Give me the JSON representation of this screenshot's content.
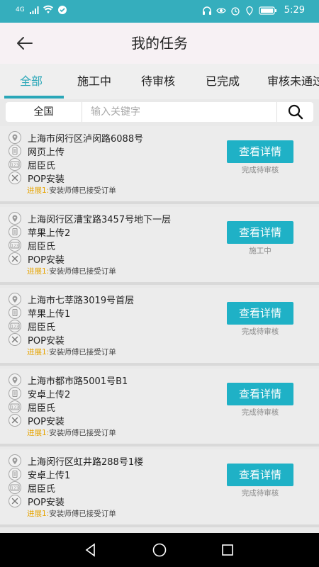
{
  "statusbar": {
    "signal": "4G",
    "time": "5:29"
  },
  "header": {
    "title": "我的任务"
  },
  "tabs": [
    {
      "label": "全部",
      "active": true
    },
    {
      "label": "施工中"
    },
    {
      "label": "待审核"
    },
    {
      "label": "已完成"
    },
    {
      "label": "审核未通过"
    }
  ],
  "search": {
    "region": "全国",
    "placeholder": "输入关键字"
  },
  "tasks": [
    {
      "address": "上海市闵行区泸闵路6088号",
      "upload": "网页上传",
      "name": "屈臣氏",
      "type": "POP安装",
      "progress_tag": "进展1:",
      "progress_text": "安装师傅已接受订单",
      "button": "查看详情",
      "status": "完成待审核"
    },
    {
      "address": "上海闵行区漕宝路3457号地下一层",
      "upload": "苹果上传2",
      "name": "屈臣氏",
      "type": "POP安装",
      "progress_tag": "进展1:",
      "progress_text": "安装师傅已接受订单",
      "button": "查看详情",
      "status": "施工中"
    },
    {
      "address": "上海市七莘路3019号首层",
      "upload": "苹果上传1",
      "name": "屈臣氏",
      "type": "POP安装",
      "progress_tag": "进展1:",
      "progress_text": "安装师傅已接受订单",
      "button": "查看详情",
      "status": "完成待审核"
    },
    {
      "address": "上海市都市路5001号B1",
      "upload": "安卓上传2",
      "name": "屈臣氏",
      "type": "POP安装",
      "progress_tag": "进展1:",
      "progress_text": "安装师傅已接受订单",
      "button": "查看详情",
      "status": "完成待审核"
    },
    {
      "address": "上海闵行区虹井路288号1楼",
      "upload": "安卓上传1",
      "name": "屈臣氏",
      "type": "POP安装",
      "progress_tag": "进展1:",
      "progress_text": "安装师傅已接受订单",
      "button": "查看详情",
      "status": "完成待审核"
    }
  ],
  "colors": {
    "accent": "#2aa7b8",
    "button": "#1fb1c6",
    "progress_tag": "#e6a400",
    "statusbar": "#35aebd"
  },
  "icons": [
    "location-icon",
    "document-icon",
    "number-icon",
    "tools-icon",
    "search-icon",
    "back-arrow-icon"
  ]
}
